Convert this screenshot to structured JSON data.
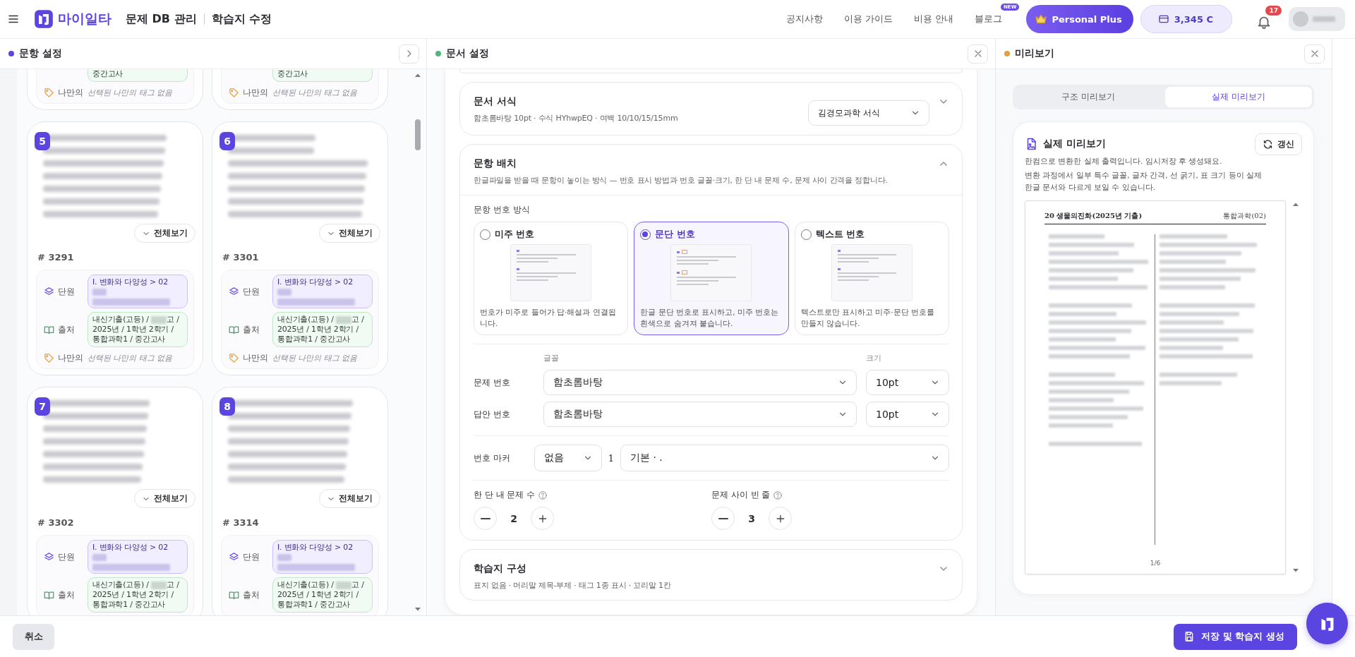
{
  "topbar": {
    "logo_text": "마이일타",
    "title": "문제 DB 관리",
    "subtitle": "학습지 수정",
    "nav": [
      {
        "label": "공지사항"
      },
      {
        "label": "이용 가이드"
      },
      {
        "label": "비용 안내"
      },
      {
        "label": "블로그",
        "badge": "NEW"
      }
    ],
    "plan": "Personal Plus",
    "credits": "3,345 C",
    "notifications": "17"
  },
  "item_panel": {
    "title": "문항 설정",
    "cards": [
      {
        "kind": "partial",
        "source_tail": "중간고사",
        "tag_label": "나만의",
        "tag_empty": "선택된 나만의 태그 없음"
      },
      {
        "kind": "partial",
        "source_tail": "중간고사",
        "tag_label": "나만의",
        "tag_empty": "선택된 나만의 태그 없음"
      },
      {
        "kind": "full",
        "number": "5",
        "expand": "전체보기",
        "id": "# 3291",
        "unit_label": "단원",
        "unit": "I. 변화와 다양성 > 02",
        "source_label": "출처",
        "source_before": "내신기출(고등) / ",
        "source_after": "고 / 2025년 / 1학년 2학기 / 통합과학1 / 중간고사",
        "tag_label": "나만의",
        "tag_empty": "선택된 나만의 태그 없음"
      },
      {
        "kind": "full",
        "number": "6",
        "expand": "전체보기",
        "id": "# 3301",
        "unit_label": "단원",
        "unit": "I. 변화와 다양성 > 02",
        "source_label": "출처",
        "source_before": "내신기출(고등) / ",
        "source_after": "고 / 2025년 / 1학년 2학기 / 통합과학1 / 중간고사",
        "tag_label": "나만의",
        "tag_empty": "선택된 나만의 태그 없음"
      },
      {
        "kind": "full",
        "number": "7",
        "expand": "전체보기",
        "id": "# 3302",
        "unit_label": "단원",
        "unit": "I. 변화와 다양성 > 02",
        "source_label": "출처",
        "source_before": "내신기출(고등) / ",
        "source_after": "고 / 2025년 / 1학년 2학기 / 통합과학1 / 중간고사"
      },
      {
        "kind": "full",
        "number": "8",
        "expand": "전체보기",
        "id": "# 3314",
        "unit_label": "단원",
        "unit": "I. 변화와 다양성 > 02",
        "source_label": "출처",
        "source_before": "내신기출(고등) / ",
        "source_after": "고 / 2025년 / 1학년 2학기 / 통합과학1 / 중간고사"
      }
    ]
  },
  "doc_panel": {
    "title": "문서 설정",
    "sections": [
      {
        "kind": "summary",
        "title": "문서 서식",
        "summary": "함초롬바탕 10pt · 수식 HYhwpEQ · 여백 10/10/15/15mm",
        "preset": "김경모과학 서식",
        "expanded": false
      },
      {
        "kind": "layout",
        "title": "문항 배치",
        "summary": "한글파일을 받을 때 문항이 놓이는 방식 — 번호 표시 방법과 번호 글꼴·크기, 한 단 내 문제 수, 문제 사이 간격을 정합니다.",
        "expanded": true,
        "numbering_label": "문항 번호 방식",
        "numbering_options": [
          {
            "kind": "endnote",
            "label": "미주 번호",
            "description": "번호가 미주로 들어가 답·해설과 연결됩니다.",
            "selected": false
          },
          {
            "kind": "paragraph",
            "label": "문단 번호",
            "description": "한글 문단 번호로 표시하고, 미주 번호는 흰색으로 숨겨져 붙습니다.",
            "selected": true
          },
          {
            "kind": "text",
            "label": "텍스트 번호",
            "description": "텍스트로만 표시하고 미주·문단 번호를 만들지 않습니다.",
            "selected": false
          }
        ],
        "font_header": "글꼴",
        "size_header": "크기",
        "font_rows": [
          {
            "label": "문제 번호",
            "font": "함초롬바탕",
            "size": "10pt"
          },
          {
            "label": "답안 번호",
            "font": "함초롬바탕",
            "size": "10pt"
          }
        ],
        "marker": {
          "label": "번호 마커",
          "style": "없음",
          "sample": "1",
          "format": "기본 · ."
        },
        "steppers": [
          {
            "label": "한 단 내 문제 수",
            "value": "2"
          },
          {
            "label": "문제 사이 빈 줄",
            "value": "3"
          }
        ]
      },
      {
        "kind": "summary",
        "title": "학습지 구성",
        "summary": "표지 없음 · 머리말 제목-부제 · 태그 1종 표시 · 꼬리말 1칸",
        "expanded": false
      }
    ]
  },
  "preview_panel": {
    "title": "미리보기",
    "tabs": [
      {
        "label": "구조 미리보기",
        "selected": false
      },
      {
        "label": "실제 미리보기",
        "selected": true
      }
    ],
    "card_title": "실제 미리보기",
    "refresh": "갱신",
    "notes": [
      "한컴으로 변환한 실제 출력입니다. 임시저장 후 생성돼요.",
      "변환 과정에서 일부 특수 글꼴, 글자 간격, 선 굵기, 표 크기 등이 실제 한글 문서와 다르게 보일 수 있습니다."
    ],
    "page": {
      "header_left": "20 생물의진화(2025년 기출)",
      "header_right": "통합과학(02)",
      "page_number": "1/6"
    }
  },
  "footer": {
    "cancel": "취소",
    "save": "저장 및 학습지 생성"
  }
}
